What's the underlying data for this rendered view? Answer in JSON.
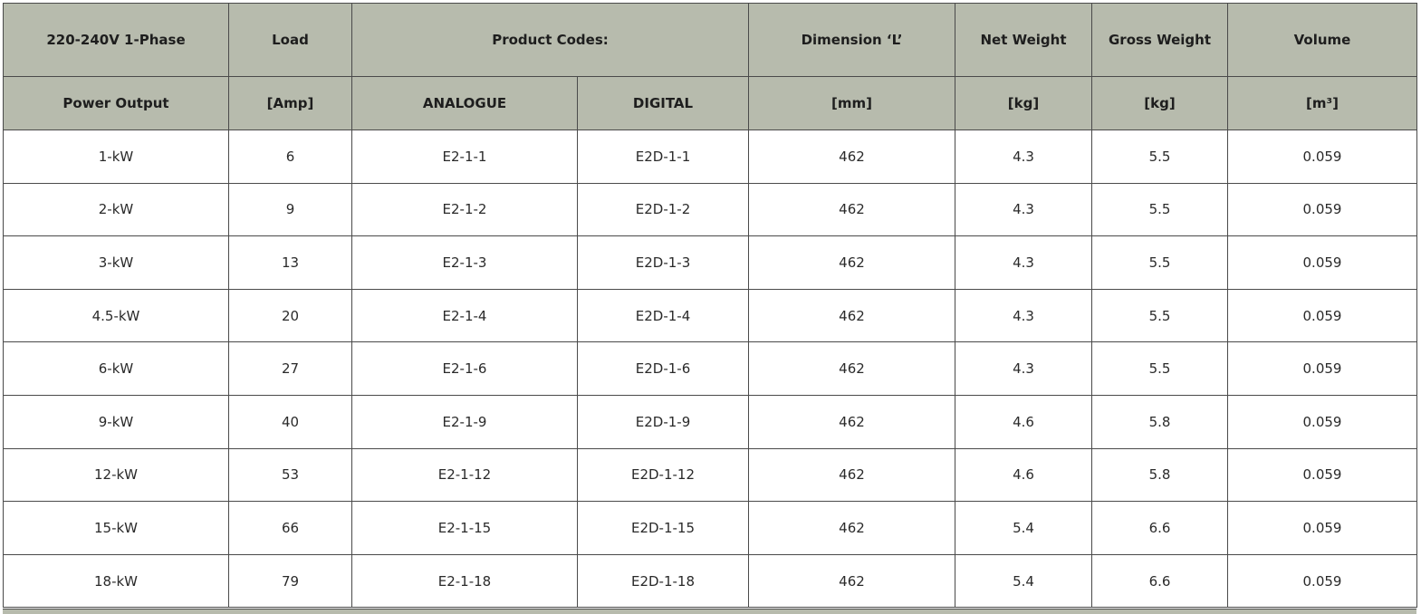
{
  "header_row_1": {
    "power": "220-240V 1-Phase",
    "load": "Load",
    "product_codes": "Product Codes:",
    "dimension": "Dimension ‘L’",
    "net_weight": "Net Weight",
    "gross_weight": "Gross Weight",
    "volume": "Volume"
  },
  "header_row_2": {
    "power": "Power Output",
    "load": "[Amp]",
    "analogue": "ANALOGUE",
    "digital": "DIGITAL",
    "dimension": "[mm]",
    "net_weight": "[kg]",
    "gross_weight": "[kg]",
    "volume": "[m³]"
  },
  "rows": [
    {
      "power": "1-kW",
      "load": "6",
      "analogue": "E2-1-1",
      "digital": "E2D-1-1",
      "dimension": "462",
      "net": "4.3",
      "gross": "5.5",
      "volume": "0.059"
    },
    {
      "power": "2-kW",
      "load": "9",
      "analogue": "E2-1-2",
      "digital": "E2D-1-2",
      "dimension": "462",
      "net": "4.3",
      "gross": "5.5",
      "volume": "0.059"
    },
    {
      "power": "3-kW",
      "load": "13",
      "analogue": "E2-1-3",
      "digital": "E2D-1-3",
      "dimension": "462",
      "net": "4.3",
      "gross": "5.5",
      "volume": "0.059"
    },
    {
      "power": "4.5-kW",
      "load": "20",
      "analogue": "E2-1-4",
      "digital": "E2D-1-4",
      "dimension": "462",
      "net": "4.3",
      "gross": "5.5",
      "volume": "0.059"
    },
    {
      "power": "6-kW",
      "load": "27",
      "analogue": "E2-1-6",
      "digital": "E2D-1-6",
      "dimension": "462",
      "net": "4.3",
      "gross": "5.5",
      "volume": "0.059"
    },
    {
      "power": "9-kW",
      "load": "40",
      "analogue": "E2-1-9",
      "digital": "E2D-1-9",
      "dimension": "462",
      "net": "4.6",
      "gross": "5.8",
      "volume": "0.059"
    },
    {
      "power": "12-kW",
      "load": "53",
      "analogue": "E2-1-12",
      "digital": "E2D-1-12",
      "dimension": "462",
      "net": "4.6",
      "gross": "5.8",
      "volume": "0.059"
    },
    {
      "power": "15-kW",
      "load": "66",
      "analogue": "E2-1-15",
      "digital": "E2D-1-15",
      "dimension": "462",
      "net": "5.4",
      "gross": "6.6",
      "volume": "0.059"
    },
    {
      "power": "18-kW",
      "load": "79",
      "analogue": "E2-1-18",
      "digital": "E2D-1-18",
      "dimension": "462",
      "net": "5.4",
      "gross": "6.6",
      "volume": "0.059"
    }
  ],
  "colors": {
    "header_background": "#b7bbad",
    "border": "#4a4a4a",
    "cell_background": "#ffffff"
  }
}
